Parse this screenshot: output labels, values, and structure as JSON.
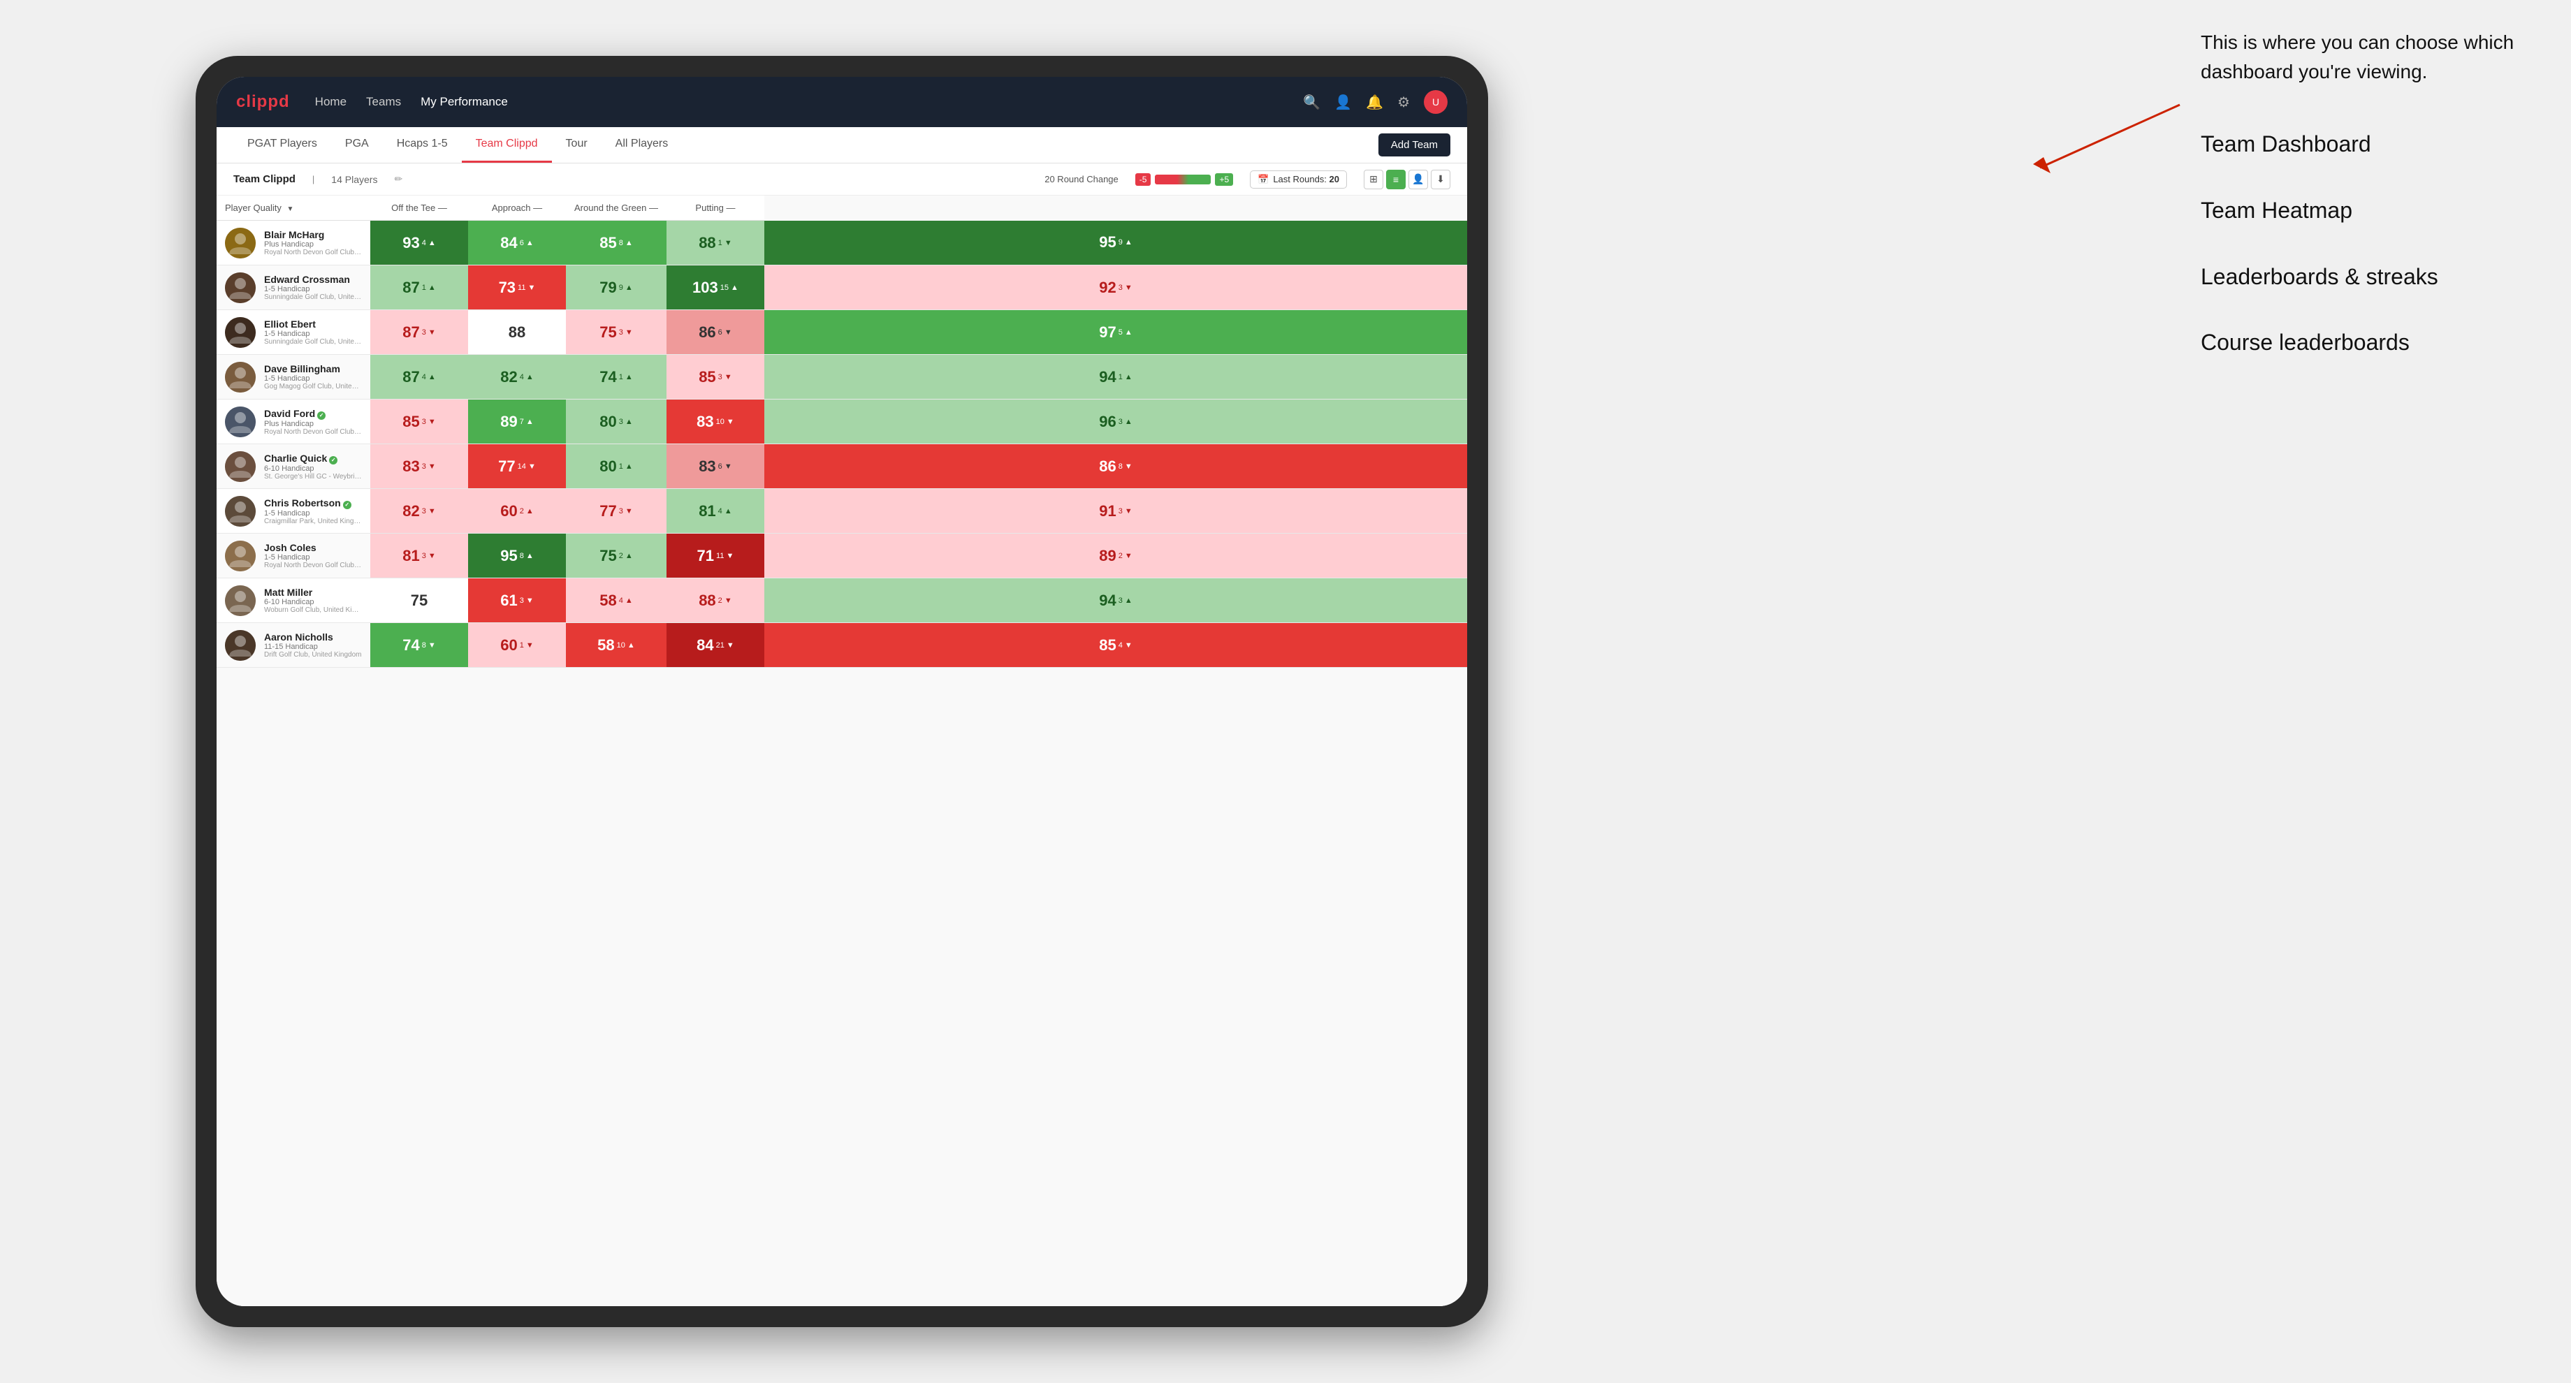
{
  "annotation": {
    "intro": "This is where you can choose which dashboard you're viewing.",
    "items": [
      "Team Dashboard",
      "Team Heatmap",
      "Leaderboards & streaks",
      "Course leaderboards"
    ]
  },
  "nav": {
    "logo": "clippd",
    "links": [
      "Home",
      "Teams",
      "My Performance"
    ],
    "active_link": "My Performance",
    "icons": [
      "search",
      "user",
      "bell",
      "settings",
      "avatar"
    ]
  },
  "sub_nav": {
    "tabs": [
      "PGAT Players",
      "PGA",
      "Hcaps 1-5",
      "Team Clippd",
      "Tour",
      "All Players"
    ],
    "active_tab": "Team Clippd",
    "add_team_label": "Add Team"
  },
  "team_bar": {
    "team_name": "Team Clippd",
    "player_count": "14 Players",
    "round_change_label": "20 Round Change",
    "change_neg": "-5",
    "change_pos": "+5",
    "last_rounds_label": "Last Rounds:",
    "last_rounds_value": "20"
  },
  "table": {
    "columns": [
      {
        "key": "player",
        "label": "Player Quality ▼"
      },
      {
        "key": "off_tee",
        "label": "Off the Tee —"
      },
      {
        "key": "approach",
        "label": "Approach —"
      },
      {
        "key": "around_green",
        "label": "Around the Green —"
      },
      {
        "key": "putting",
        "label": "Putting —"
      }
    ],
    "rows": [
      {
        "name": "Blair McHarg",
        "badge": null,
        "handicap": "Plus Handicap",
        "club": "Royal North Devon Golf Club, United Kingdom",
        "avatar_color": "#8B6914",
        "off_tee": {
          "value": 93,
          "change": 4,
          "dir": "up",
          "bg": "green-dark"
        },
        "approach": {
          "value": 84,
          "change": 6,
          "dir": "up",
          "bg": "green-mid"
        },
        "around_green": {
          "value": 85,
          "change": 8,
          "dir": "up",
          "bg": "green-mid"
        },
        "putting": {
          "value": 88,
          "change": 1,
          "dir": "down",
          "bg": "green-pale"
        },
        "quality": {
          "value": 95,
          "change": 9,
          "dir": "up",
          "bg": "green-dark"
        }
      },
      {
        "name": "Edward Crossman",
        "badge": null,
        "handicap": "1-5 Handicap",
        "club": "Sunningdale Golf Club, United Kingdom",
        "avatar_color": "#5a3e2b",
        "off_tee": {
          "value": 87,
          "change": 1,
          "dir": "up",
          "bg": "green-pale"
        },
        "approach": {
          "value": 73,
          "change": 11,
          "dir": "down",
          "bg": "red-mid"
        },
        "around_green": {
          "value": 79,
          "change": 9,
          "dir": "up",
          "bg": "green-pale"
        },
        "putting": {
          "value": 103,
          "change": 15,
          "dir": "up",
          "bg": "green-dark"
        },
        "quality": {
          "value": 92,
          "change": 3,
          "dir": "down",
          "bg": "red-pale"
        }
      },
      {
        "name": "Elliot Ebert",
        "badge": null,
        "handicap": "1-5 Handicap",
        "club": "Sunningdale Golf Club, United Kingdom",
        "avatar_color": "#3d2b1f",
        "off_tee": {
          "value": 87,
          "change": 3,
          "dir": "down",
          "bg": "red-pale"
        },
        "approach": {
          "value": 88,
          "change": null,
          "dir": null,
          "bg": "white"
        },
        "around_green": {
          "value": 75,
          "change": 3,
          "dir": "down",
          "bg": "red-pale"
        },
        "putting": {
          "value": 86,
          "change": 6,
          "dir": "down",
          "bg": "red-light"
        },
        "quality": {
          "value": 97,
          "change": 5,
          "dir": "up",
          "bg": "green-mid"
        }
      },
      {
        "name": "Dave Billingham",
        "badge": null,
        "handicap": "1-5 Handicap",
        "club": "Gog Magog Golf Club, United Kingdom",
        "avatar_color": "#7a5c3e",
        "off_tee": {
          "value": 87,
          "change": 4,
          "dir": "up",
          "bg": "green-pale"
        },
        "approach": {
          "value": 82,
          "change": 4,
          "dir": "up",
          "bg": "green-pale"
        },
        "around_green": {
          "value": 74,
          "change": 1,
          "dir": "up",
          "bg": "green-pale"
        },
        "putting": {
          "value": 85,
          "change": 3,
          "dir": "down",
          "bg": "red-pale"
        },
        "quality": {
          "value": 94,
          "change": 1,
          "dir": "up",
          "bg": "green-pale"
        }
      },
      {
        "name": "David Ford",
        "badge": "verified",
        "handicap": "Plus Handicap",
        "club": "Royal North Devon Golf Club, United Kingdom",
        "avatar_color": "#4a5568",
        "off_tee": {
          "value": 85,
          "change": 3,
          "dir": "down",
          "bg": "red-pale"
        },
        "approach": {
          "value": 89,
          "change": 7,
          "dir": "up",
          "bg": "green-mid"
        },
        "around_green": {
          "value": 80,
          "change": 3,
          "dir": "up",
          "bg": "green-pale"
        },
        "putting": {
          "value": 83,
          "change": 10,
          "dir": "down",
          "bg": "red-mid"
        },
        "quality": {
          "value": 96,
          "change": 3,
          "dir": "up",
          "bg": "green-pale"
        }
      },
      {
        "name": "Charlie Quick",
        "badge": "verified",
        "handicap": "6-10 Handicap",
        "club": "St. George's Hill GC - Weybridge - Surrey, Uni...",
        "avatar_color": "#6b4f3e",
        "off_tee": {
          "value": 83,
          "change": 3,
          "dir": "down",
          "bg": "red-pale"
        },
        "approach": {
          "value": 77,
          "change": 14,
          "dir": "down",
          "bg": "red-mid"
        },
        "around_green": {
          "value": 80,
          "change": 1,
          "dir": "up",
          "bg": "green-pale"
        },
        "putting": {
          "value": 83,
          "change": 6,
          "dir": "down",
          "bg": "red-light"
        },
        "quality": {
          "value": 86,
          "change": 8,
          "dir": "down",
          "bg": "red-mid"
        }
      },
      {
        "name": "Chris Robertson",
        "badge": "verified",
        "handicap": "1-5 Handicap",
        "club": "Craigmillar Park, United Kingdom",
        "avatar_color": "#5c4a3a",
        "off_tee": {
          "value": 82,
          "change": 3,
          "dir": "down",
          "bg": "red-pale"
        },
        "approach": {
          "value": 60,
          "change": 2,
          "dir": "up",
          "bg": "red-pale"
        },
        "around_green": {
          "value": 77,
          "change": 3,
          "dir": "down",
          "bg": "red-pale"
        },
        "putting": {
          "value": 81,
          "change": 4,
          "dir": "up",
          "bg": "green-pale"
        },
        "quality": {
          "value": 91,
          "change": 3,
          "dir": "down",
          "bg": "red-pale"
        }
      },
      {
        "name": "Josh Coles",
        "badge": null,
        "handicap": "1-5 Handicap",
        "club": "Royal North Devon Golf Club, United Kingdom",
        "avatar_color": "#8c6e4b",
        "off_tee": {
          "value": 81,
          "change": 3,
          "dir": "down",
          "bg": "red-pale"
        },
        "approach": {
          "value": 95,
          "change": 8,
          "dir": "up",
          "bg": "green-dark"
        },
        "around_green": {
          "value": 75,
          "change": 2,
          "dir": "up",
          "bg": "green-pale"
        },
        "putting": {
          "value": 71,
          "change": 11,
          "dir": "down",
          "bg": "red-dark"
        },
        "quality": {
          "value": 89,
          "change": 2,
          "dir": "down",
          "bg": "red-pale"
        }
      },
      {
        "name": "Matt Miller",
        "badge": null,
        "handicap": "6-10 Handicap",
        "club": "Woburn Golf Club, United Kingdom",
        "avatar_color": "#7a6651",
        "off_tee": {
          "value": 75,
          "change": null,
          "dir": null,
          "bg": "white"
        },
        "approach": {
          "value": 61,
          "change": 3,
          "dir": "down",
          "bg": "red-mid"
        },
        "around_green": {
          "value": 58,
          "change": 4,
          "dir": "up",
          "bg": "red-pale"
        },
        "putting": {
          "value": 88,
          "change": 2,
          "dir": "down",
          "bg": "red-pale"
        },
        "quality": {
          "value": 94,
          "change": 3,
          "dir": "up",
          "bg": "green-pale"
        }
      },
      {
        "name": "Aaron Nicholls",
        "badge": null,
        "handicap": "11-15 Handicap",
        "club": "Drift Golf Club, United Kingdom",
        "avatar_color": "#4a3728",
        "off_tee": {
          "value": 74,
          "change": 8,
          "dir": "down",
          "bg": "green-mid"
        },
        "approach": {
          "value": 60,
          "change": 1,
          "dir": "down",
          "bg": "red-pale"
        },
        "around_green": {
          "value": 58,
          "change": 10,
          "dir": "up",
          "bg": "red-mid"
        },
        "putting": {
          "value": 84,
          "change": 21,
          "dir": "down",
          "bg": "red-dark"
        },
        "quality": {
          "value": 85,
          "change": 4,
          "dir": "down",
          "bg": "red-mid"
        }
      }
    ]
  }
}
